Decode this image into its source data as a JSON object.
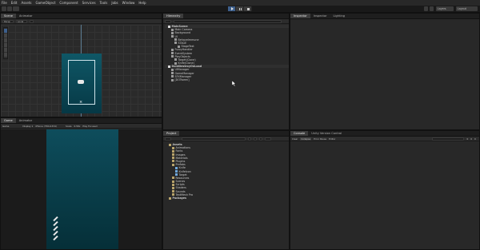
{
  "menu": [
    "File",
    "Edit",
    "Assets",
    "GameObject",
    "Component",
    "Services",
    "Tools",
    "Jobs",
    "Window",
    "Help"
  ],
  "toolbar": {
    "layers": "Layers",
    "layout": "Layout"
  },
  "scene_panel": {
    "tabs": [
      "Scene",
      "Animator"
    ],
    "persp": "Persp",
    "shading": "Local"
  },
  "game_panel": {
    "tabs": [
      "Game",
      "Animator"
    ],
    "display": "Display 1",
    "resolution": "iPhone (750x1334)",
    "scale_label": "Scale",
    "scale_value": "0.58x",
    "play_mode": "Play Focused"
  },
  "hierarchy": {
    "tab": "Hierarchy",
    "items": [
      {
        "label": "MainScene",
        "depth": 0,
        "kind": "scene"
      },
      {
        "label": "Main Camera",
        "depth": 1,
        "kind": "obj"
      },
      {
        "label": "Background",
        "depth": 1,
        "kind": "obj"
      },
      {
        "label": "UI",
        "depth": 1,
        "kind": "obj"
      },
      {
        "label": "BehaveImmune",
        "depth": 2,
        "kind": "obj"
      },
      {
        "label": "STAGE",
        "depth": 2,
        "kind": "obj"
      },
      {
        "label": "StageText",
        "depth": 3,
        "kind": "obj"
      },
      {
        "label": "FuzzyHandler",
        "depth": 1,
        "kind": "obj"
      },
      {
        "label": "EventSystem",
        "depth": 1,
        "kind": "obj"
      },
      {
        "label": "PlayObjects",
        "depth": 1,
        "kind": "obj"
      },
      {
        "label": "Target(Clone)",
        "depth": 2,
        "kind": "obj"
      },
      {
        "label": "Knife(Clone)",
        "depth": 2,
        "kind": "obj"
      },
      {
        "label": "DontDestroyOnLoad",
        "depth": 0,
        "kind": "scene"
      },
      {
        "label": "UIManager",
        "depth": 1,
        "kind": "obj"
      },
      {
        "label": "GameManager",
        "depth": 1,
        "kind": "obj"
      },
      {
        "label": "SFXManager",
        "depth": 1,
        "kind": "obj"
      },
      {
        "label": "[DOTween]",
        "depth": 1,
        "kind": "obj"
      }
    ]
  },
  "inspector": {
    "tabs": [
      "Inspector",
      "Inspector",
      "Lighting"
    ]
  },
  "project": {
    "tab": "Project",
    "items": [
      {
        "label": "Assets",
        "depth": 0,
        "kind": "folder-open"
      },
      {
        "label": "Animations",
        "depth": 1,
        "kind": "folder"
      },
      {
        "label": "Fonts",
        "depth": 1,
        "kind": "folder"
      },
      {
        "label": "Images",
        "depth": 1,
        "kind": "folder"
      },
      {
        "label": "Materials",
        "depth": 1,
        "kind": "folder"
      },
      {
        "label": "Plugins",
        "depth": 1,
        "kind": "folder"
      },
      {
        "label": "Prefabs",
        "depth": 1,
        "kind": "folder-open"
      },
      {
        "label": "Knife",
        "depth": 2,
        "kind": "prefab"
      },
      {
        "label": "KnifeIcon",
        "depth": 2,
        "kind": "prefab"
      },
      {
        "label": "Target",
        "depth": 2,
        "kind": "prefab"
      },
      {
        "label": "Resources",
        "depth": 1,
        "kind": "folder"
      },
      {
        "label": "Scenes",
        "depth": 1,
        "kind": "folder"
      },
      {
        "label": "Scripts",
        "depth": 1,
        "kind": "folder"
      },
      {
        "label": "Shaders",
        "depth": 1,
        "kind": "folder"
      },
      {
        "label": "Sounds",
        "depth": 1,
        "kind": "folder"
      },
      {
        "label": "TextMesh Pro",
        "depth": 1,
        "kind": "folder"
      },
      {
        "label": "Packages",
        "depth": 0,
        "kind": "folder"
      }
    ]
  },
  "console": {
    "tabs": [
      "Console",
      "Unity Version Control"
    ],
    "clear": "Clear",
    "collapse": "Collapse",
    "error_pause": "Error Pause",
    "editor": "Editor",
    "counts": [
      "0",
      "0",
      "0"
    ]
  },
  "colors": {
    "bg": "#191919",
    "panel": "#282828",
    "accent": "#3d5f8c",
    "game_teal_top": "#0e4d5c",
    "game_teal_bottom": "#052f38"
  }
}
